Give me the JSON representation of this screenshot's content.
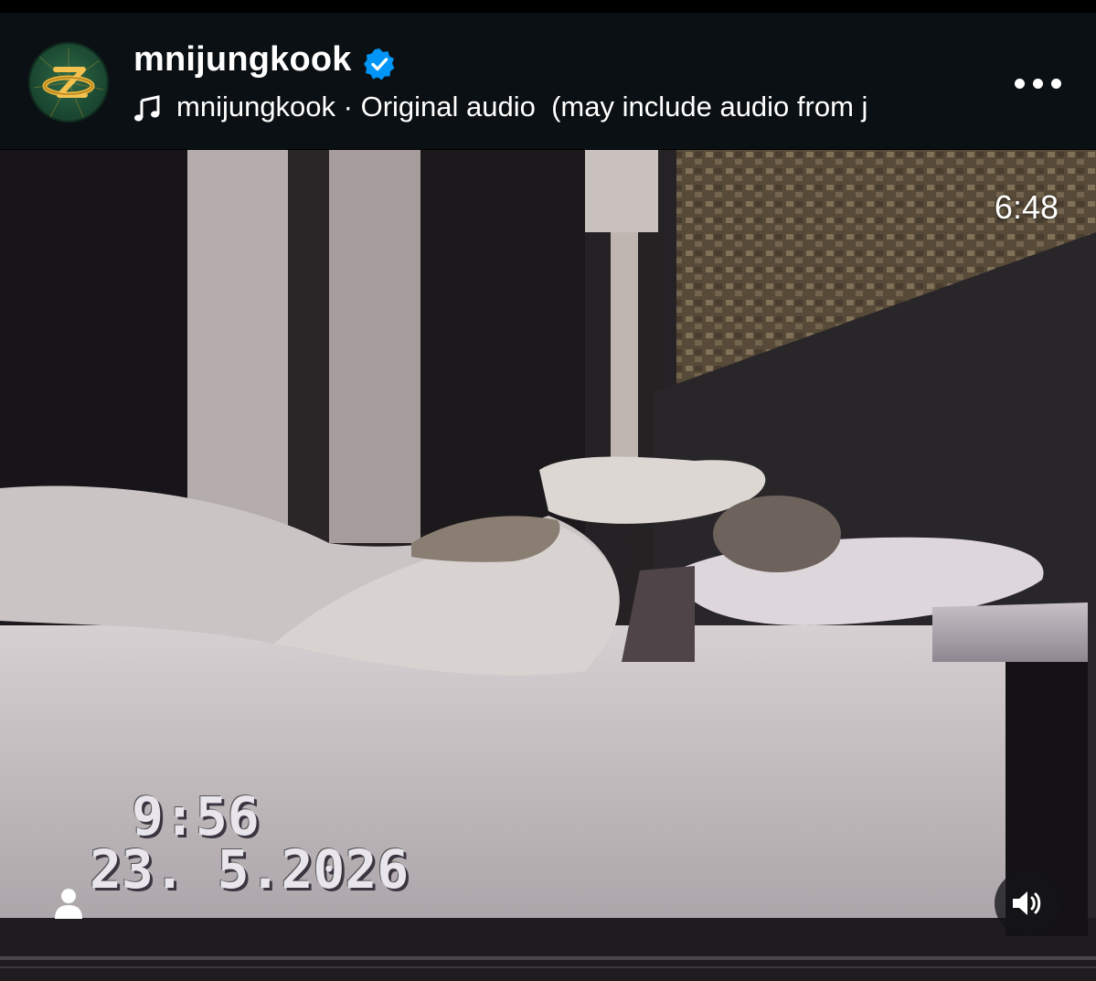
{
  "header": {
    "username": "mnijungkook",
    "verified_icon": "verified-badge-icon",
    "audio_icon": "music-note-icon",
    "audio_text": "mnijungkook · Original audio  (may include audio from j",
    "more_icon": "more-options-icon"
  },
  "video": {
    "duration": "6:48",
    "overlay_time": "9:56",
    "overlay_date": "23. 5.2026",
    "user_icon": "person-icon",
    "sound_icon": "speaker-volume-icon"
  },
  "colors": {
    "header_bg": "#0b1014",
    "verified_blue": "#0095f6",
    "avatar_green": "#1c4a33",
    "avatar_gold": "#d9a630"
  }
}
